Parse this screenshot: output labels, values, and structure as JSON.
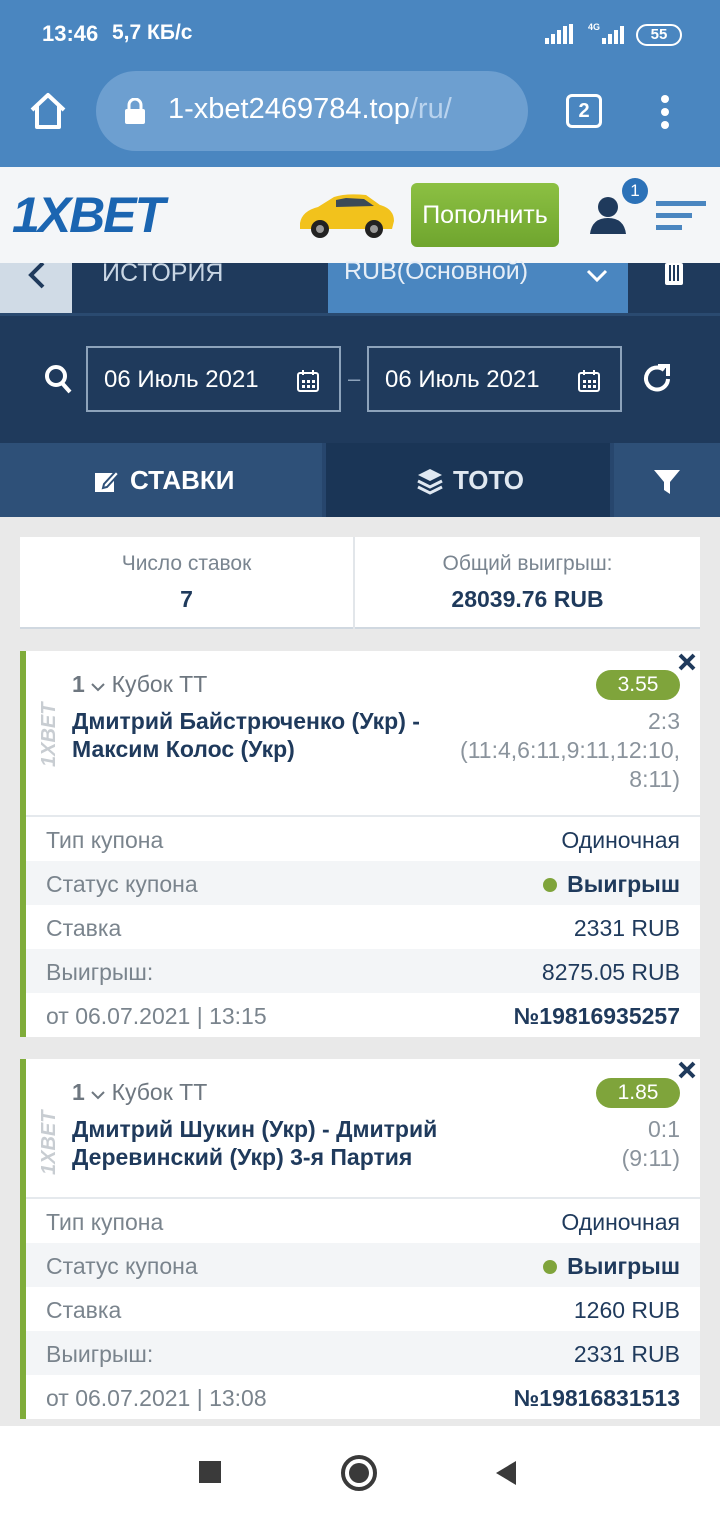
{
  "status_bar": {
    "time": "13:46",
    "speed": "5,7 КБ/с",
    "network": "4G",
    "battery": "55"
  },
  "browser": {
    "url_main": "1-xbet2469784.top",
    "url_path": "/ru/",
    "tab_count": "2"
  },
  "site": {
    "logo": "1XBET",
    "deposit_label": "Пополнить",
    "notification_count": "1",
    "brand_color": "#1b65b1"
  },
  "history": {
    "title": "ИСТОРИЯ",
    "currency": "RUB(Основной)"
  },
  "filters": {
    "date_from": "06 Июль 2021",
    "date_to": "06 Июль 2021",
    "separator": "–"
  },
  "tabs": [
    {
      "label": "СТАВКИ"
    },
    {
      "label": "ТОТО"
    }
  ],
  "summary": {
    "bets_label": "Число ставок",
    "bets_value": "7",
    "total_label": "Общий выигрыш:",
    "total_value": "28039.76 RUB"
  },
  "bets": [
    {
      "count": "1",
      "league": "Кубок ТТ",
      "match": "Дмитрий Байстрюченко (Укр) - Максим Колос (Укр)",
      "odds": "3.55",
      "score": "2:3",
      "score_detail": "(11:4,6:11,9:11,12:10,8:11)",
      "type_label": "Тип купона",
      "type_value": "Одиночная",
      "status_label": "Статус купона",
      "status_value": "Выигрыш",
      "stake_label": "Ставка",
      "stake_value": "2331 RUB",
      "win_label": "Выигрыш:",
      "win_value": "8275.05 RUB",
      "date": "от 06.07.2021 | 13:15",
      "number": "№19816935257"
    },
    {
      "count": "1",
      "league": "Кубок ТТ",
      "match": "Дмитрий Шукин (Укр) - Дмитрий Деревинский (Укр) 3-я Партия",
      "odds": "1.85",
      "score": "0:1",
      "score_detail": "(9:11)",
      "type_label": "Тип купона",
      "type_value": "Одиночная",
      "status_label": "Статус купона",
      "status_value": "Выигрыш",
      "stake_label": "Ставка",
      "stake_value": "1260 RUB",
      "win_label": "Выигрыш:",
      "win_value": "2331 RUB",
      "date": "от 06.07.2021 | 13:08",
      "number": "№19816831513"
    }
  ]
}
